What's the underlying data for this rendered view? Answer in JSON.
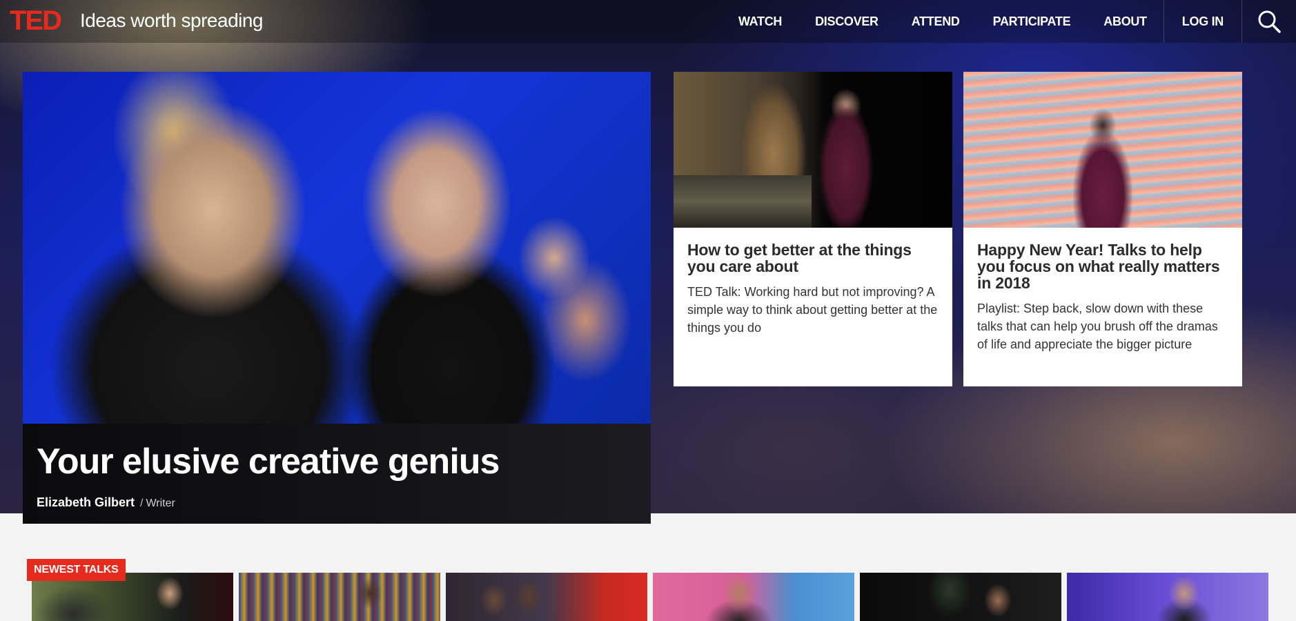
{
  "brand": {
    "logo": "TED",
    "tagline": "Ideas worth spreading",
    "logo_color": "#e62b1e"
  },
  "nav": {
    "items": [
      {
        "label": "WATCH"
      },
      {
        "label": "DISCOVER"
      },
      {
        "label": "ATTEND"
      },
      {
        "label": "PARTICIPATE"
      },
      {
        "label": "ABOUT"
      }
    ],
    "login_label": "LOG IN",
    "search_icon": "search-icon"
  },
  "feature": {
    "title": "Your elusive creative genius",
    "speaker": "Elizabeth Gilbert",
    "separator": "/",
    "role": "Writer"
  },
  "cards": [
    {
      "title": "How to get better at the things you care about",
      "description": "TED Talk: Working hard but not improving? A simple way to think about getting better at the things you do"
    },
    {
      "title": "Happy New Year! Talks to help you focus on what really matters in 2018",
      "description": "Playlist: Step back, slow down with these talks that can help you brush off the dramas of life and appreciate the bigger picture"
    }
  ],
  "newest": {
    "label": "NEWEST TALKS",
    "label_color": "#e62b1e"
  }
}
